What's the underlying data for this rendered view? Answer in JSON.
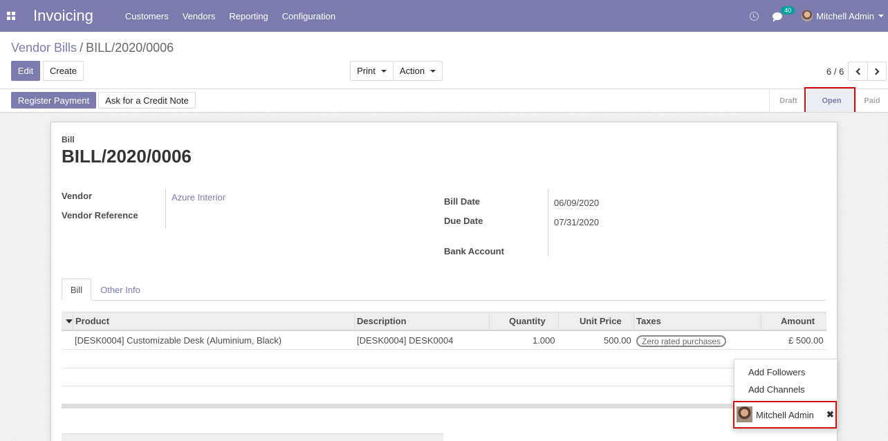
{
  "app": {
    "title": "Invoicing"
  },
  "menu": [
    "Customers",
    "Vendors",
    "Reporting",
    "Configuration"
  ],
  "systray": {
    "chat_count": "40",
    "user_name": "Mitchell Admin"
  },
  "breadcrumb": {
    "parent": "Vendor Bills",
    "separator": "/",
    "current": "BILL/2020/0006"
  },
  "buttons": {
    "edit": "Edit",
    "create": "Create",
    "print": "Print",
    "action": "Action",
    "register_payment": "Register Payment",
    "credit_note": "Ask for a Credit Note"
  },
  "pager": {
    "value": "6 / 6"
  },
  "statusbar": {
    "stages": [
      "Draft",
      "Open",
      "Paid"
    ],
    "active": "Open"
  },
  "form": {
    "type_label": "Bill",
    "number": "BILL/2020/0006",
    "vendor_label": "Vendor",
    "vendor_value": "Azure Interior",
    "vendor_ref_label": "Vendor Reference",
    "bill_date_label": "Bill Date",
    "bill_date_value": "06/09/2020",
    "due_date_label": "Due Date",
    "due_date_value": "07/31/2020",
    "bank_account_label": "Bank Account"
  },
  "tabs": [
    "Bill",
    "Other Info"
  ],
  "table": {
    "headers": {
      "product": "Product",
      "description": "Description",
      "quantity": "Quantity",
      "unit_price": "Unit Price",
      "taxes": "Taxes",
      "amount": "Amount"
    },
    "rows": [
      {
        "product": "[DESK0004] Customizable Desk (Aluminium, Black)",
        "description": "[DESK0004] DESK0004",
        "quantity": "1.000",
        "unit_price": "500.00",
        "tax": "Zero rated purchases",
        "amount": "£ 500.00"
      }
    ]
  },
  "followers_dropdown": {
    "add_followers": "Add Followers",
    "add_channels": "Add Channels",
    "follower": "Mitchell Admin"
  },
  "colors": {
    "navbar": "#7c7bad",
    "highlight": "#d20e0e",
    "badge": "#00a09d"
  }
}
